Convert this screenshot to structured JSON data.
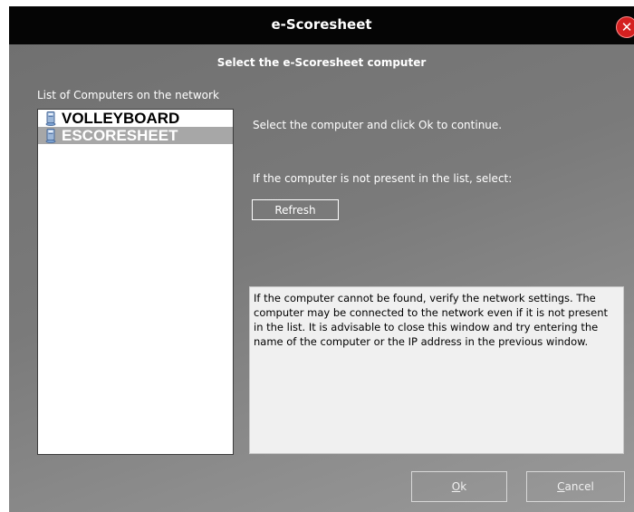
{
  "window": {
    "title": "e-Scoresheet",
    "close_icon": "close-icon",
    "close_color": "#d42020"
  },
  "header": {
    "subtitle": "Select the e-Scoresheet computer"
  },
  "computer_list": {
    "label": "List of Computers on the network",
    "item_icon": "computer-icon",
    "items": [
      {
        "name": "VOLLEYBOARD",
        "selected": false
      },
      {
        "name": "ESCORESHEET",
        "selected": true
      }
    ]
  },
  "instructions": {
    "select_text": "Select the computer and click Ok to continue.",
    "not_present_text": "If the computer is not present in the list, select:"
  },
  "buttons": {
    "refresh": "Refresh",
    "ok_mnemonic": "O",
    "ok_rest": "k",
    "cancel_mnemonic": "C",
    "cancel_rest": "ancel"
  },
  "info": {
    "text": "If the computer cannot be found, verify the network settings. The computer may be connected to the network even if it is not present in the list. It is advisable to close this window and try entering the name of the computer or the IP address in the previous window."
  }
}
